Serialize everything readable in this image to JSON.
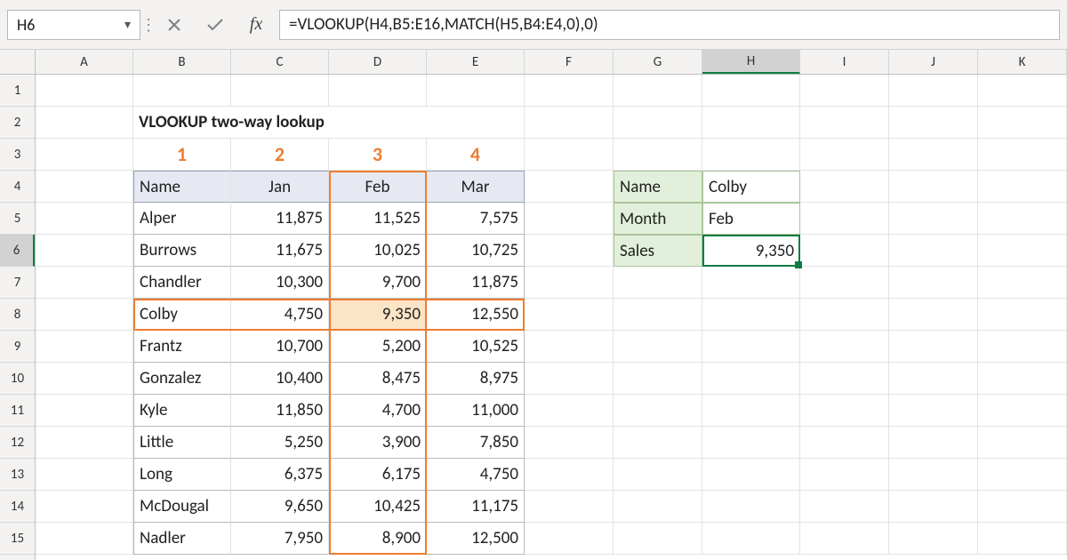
{
  "formula_bar": {
    "cell_ref": "H6",
    "formula": "=VLOOKUP(H4,B5:E16,MATCH(H5,B4:E4,0),0)"
  },
  "column_letters": [
    "A",
    "B",
    "C",
    "D",
    "E",
    "F",
    "G",
    "H",
    "I",
    "J",
    "K"
  ],
  "row_numbers": [
    "1",
    "2",
    "3",
    "4",
    "5",
    "6",
    "7",
    "8",
    "9",
    "10",
    "11",
    "12",
    "13",
    "14",
    "15"
  ],
  "title": "VLOOKUP two-way lookup",
  "col_indices": [
    "1",
    "2",
    "3",
    "4"
  ],
  "table": {
    "headers": [
      "Name",
      "Jan",
      "Feb",
      "Mar"
    ],
    "rows": [
      {
        "name": "Alper",
        "jan": "11,875",
        "feb": "11,525",
        "mar": "7,575"
      },
      {
        "name": "Burrows",
        "jan": "11,675",
        "feb": "10,025",
        "mar": "10,725"
      },
      {
        "name": "Chandler",
        "jan": "10,300",
        "feb": "9,700",
        "mar": "11,875"
      },
      {
        "name": "Colby",
        "jan": "4,750",
        "feb": "9,350",
        "mar": "12,550"
      },
      {
        "name": "Frantz",
        "jan": "10,700",
        "feb": "5,200",
        "mar": "10,525"
      },
      {
        "name": "Gonzalez",
        "jan": "10,400",
        "feb": "8,475",
        "mar": "8,975"
      },
      {
        "name": "Kyle",
        "jan": "11,850",
        "feb": "4,700",
        "mar": "11,000"
      },
      {
        "name": "Little",
        "jan": "5,250",
        "feb": "3,900",
        "mar": "7,850"
      },
      {
        "name": "Long",
        "jan": "6,375",
        "feb": "6,175",
        "mar": "4,750"
      },
      {
        "name": "McDougal",
        "jan": "9,650",
        "feb": "10,425",
        "mar": "11,175"
      },
      {
        "name": "Nadler",
        "jan": "7,950",
        "feb": "8,900",
        "mar": "12,500"
      }
    ]
  },
  "lookup": {
    "name_label": "Name",
    "name_value": "Colby",
    "month_label": "Month",
    "month_value": "Feb",
    "sales_label": "Sales",
    "sales_value": "9,350"
  },
  "chart_data": {
    "type": "table",
    "title": "VLOOKUP two-way lookup",
    "columns": [
      "Name",
      "Jan",
      "Feb",
      "Mar"
    ],
    "rows": [
      [
        "Alper",
        11875,
        11525,
        7575
      ],
      [
        "Burrows",
        11675,
        10025,
        10725
      ],
      [
        "Chandler",
        10300,
        9700,
        11875
      ],
      [
        "Colby",
        4750,
        9350,
        12550
      ],
      [
        "Frantz",
        10700,
        5200,
        10525
      ],
      [
        "Gonzalez",
        10400,
        8475,
        8975
      ],
      [
        "Kyle",
        11850,
        4700,
        11000
      ],
      [
        "Little",
        5250,
        3900,
        7850
      ],
      [
        "Long",
        6375,
        6175,
        4750
      ],
      [
        "McDougal",
        9650,
        10425,
        11175
      ],
      [
        "Nadler",
        7950,
        8900,
        12500
      ]
    ],
    "lookup": {
      "Name": "Colby",
      "Month": "Feb",
      "Sales": 9350
    },
    "formula": "=VLOOKUP(H4,B5:E16,MATCH(H5,B4:E4,0),0)"
  }
}
